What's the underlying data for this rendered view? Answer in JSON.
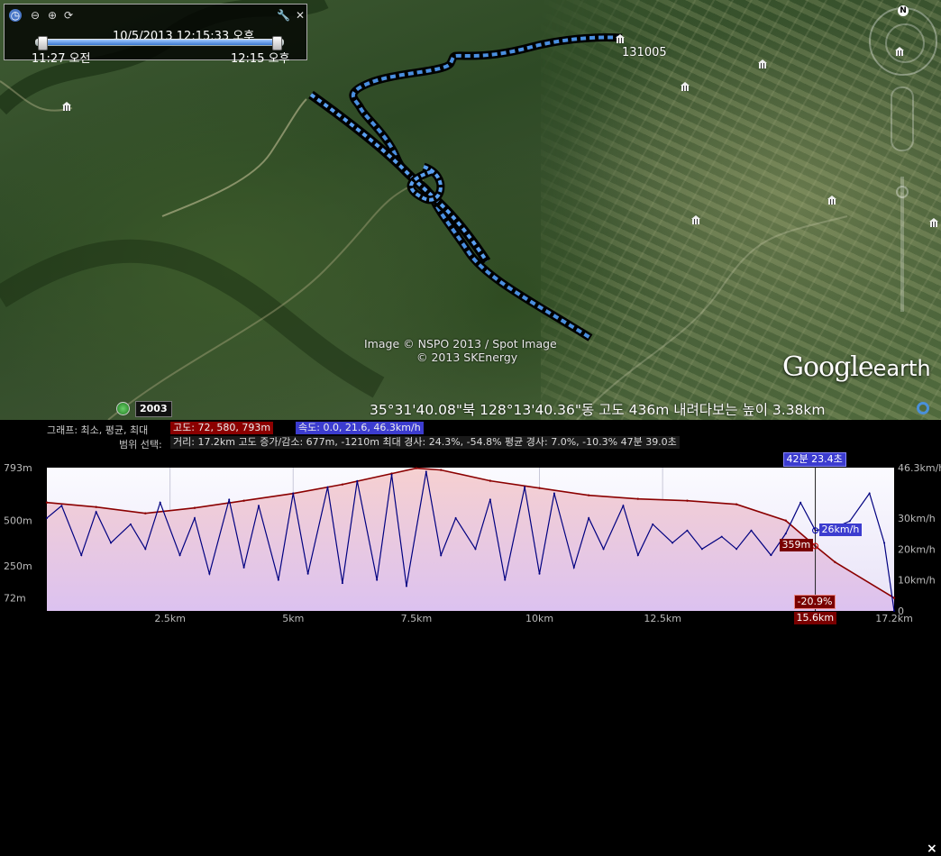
{
  "timeslider": {
    "current": "10/5/2013  12:15:33 오후",
    "start": "11:27 오전",
    "end": "12:15 오후",
    "range_fraction": [
      0.03,
      0.97
    ]
  },
  "map": {
    "track_label": "131005",
    "attribution": "Image © NSPO 2013 / Spot Image",
    "attribution2": "© 2013 SKEnergy",
    "logo_main": "Google",
    "logo_sub": "earth",
    "year": "2003"
  },
  "status": {
    "coords": "35°31'40.08\"북  128°13'40.36\"동  고도    436m    내려다보는 높이    3.38km"
  },
  "profile": {
    "graph_label": "그래프: 최소, 평균, 최대",
    "range_label": "범위 선택:",
    "elev_stats": "고도: 72, 580, 793m",
    "speed_stats": "속도: 0.0, 21.6, 46.3km/h",
    "summary": "거리: 17.2km 고도 증가/감소: 677m, -1210m  최대 경사: 24.3%, -54.8%  평균 경사: 7.0%, -10.3%  47분 39.0초",
    "close": "×",
    "time_marker": "42분 23.4초",
    "elev_marker": "359m",
    "speed_marker": "26km/h",
    "slope_marker": "-20.9%",
    "dist_marker": "15.6km"
  },
  "chart_data": {
    "type": "area",
    "xlabel": "",
    "x_ticks": [
      "2.5km",
      "5km",
      "7.5km",
      "10km",
      "12.5km",
      "17.2km"
    ],
    "x_tick_values": [
      2.5,
      5,
      7.5,
      10,
      12.5,
      17.2
    ],
    "xlim": [
      0,
      17.2
    ],
    "left_ticks": [
      "793m",
      "500m",
      "250m",
      "72m"
    ],
    "left_tick_values": [
      793,
      500,
      250,
      72
    ],
    "right_ticks": [
      "46.3km/h",
      "30km/h",
      "20km/h",
      "10km/h",
      "0"
    ],
    "right_tick_values": [
      46.3,
      30,
      20,
      10,
      0
    ],
    "ylim_elev": [
      0,
      793
    ],
    "ylim_speed": [
      0,
      46.3
    ],
    "series": [
      {
        "name": "고도",
        "color": "#8b0000",
        "x": [
          0,
          1,
          2,
          3,
          4,
          5,
          6,
          7,
          7.5,
          8,
          9,
          10,
          11,
          12,
          13,
          14,
          15,
          15.6,
          16,
          17.2
        ],
        "values": [
          600,
          575,
          540,
          570,
          610,
          650,
          700,
          760,
          790,
          780,
          720,
          680,
          640,
          620,
          610,
          590,
          500,
          359,
          270,
          72
        ]
      },
      {
        "name": "속도",
        "color": "#000080",
        "x": [
          0,
          0.3,
          0.7,
          1,
          1.3,
          1.7,
          2,
          2.3,
          2.7,
          3,
          3.3,
          3.7,
          4,
          4.3,
          4.7,
          5,
          5.3,
          5.7,
          6,
          6.3,
          6.7,
          7,
          7.3,
          7.7,
          8,
          8.3,
          8.7,
          9,
          9.3,
          9.7,
          10,
          10.3,
          10.7,
          11,
          11.3,
          11.7,
          12,
          12.3,
          12.7,
          13,
          13.3,
          13.7,
          14,
          14.3,
          14.7,
          15,
          15.3,
          15.6,
          16,
          16.3,
          16.7,
          17,
          17.2
        ],
        "values": [
          30,
          34,
          18,
          32,
          22,
          28,
          20,
          35,
          18,
          30,
          12,
          36,
          14,
          34,
          10,
          38,
          12,
          40,
          9,
          42,
          10,
          44,
          8,
          45,
          18,
          30,
          20,
          36,
          10,
          40,
          12,
          38,
          14,
          30,
          20,
          34,
          18,
          28,
          22,
          26,
          20,
          24,
          20,
          26,
          18,
          25,
          35,
          26,
          27,
          29,
          38,
          22,
          0
        ]
      }
    ],
    "markers": {
      "x": 15.6,
      "elev": 359,
      "speed": 26,
      "slope": "-20.9%"
    }
  }
}
